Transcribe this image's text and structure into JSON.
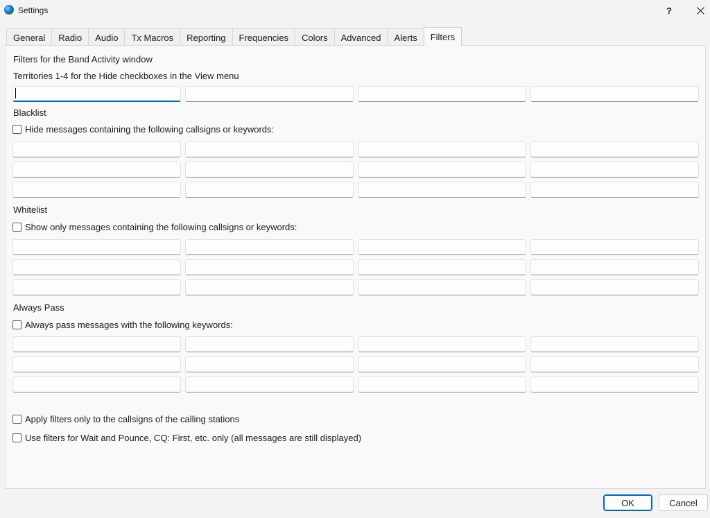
{
  "window": {
    "title": "Settings",
    "help_label": "?",
    "close_label": "close"
  },
  "tabs": [
    {
      "label": "General"
    },
    {
      "label": "Radio"
    },
    {
      "label": "Audio"
    },
    {
      "label": "Tx Macros"
    },
    {
      "label": "Reporting"
    },
    {
      "label": "Frequencies"
    },
    {
      "label": "Colors"
    },
    {
      "label": "Advanced"
    },
    {
      "label": "Alerts"
    },
    {
      "label": "Filters",
      "active": true
    }
  ],
  "filters": {
    "heading": "Filters for the Band Activity window",
    "territories": {
      "label": "Territories 1-4 for the Hide checkboxes in the View menu",
      "values": [
        "",
        "",
        "",
        ""
      ]
    },
    "blacklist": {
      "heading": "Blacklist",
      "checkbox_label": "Hide messages containing the following callsigns or keywords:",
      "checked": false,
      "values": [
        "",
        "",
        "",
        "",
        "",
        "",
        "",
        "",
        "",
        "",
        "",
        ""
      ]
    },
    "whitelist": {
      "heading": "Whitelist",
      "checkbox_label": "Show only messages containing the following callsigns or keywords:",
      "checked": false,
      "values": [
        "",
        "",
        "",
        "",
        "",
        "",
        "",
        "",
        "",
        "",
        "",
        ""
      ]
    },
    "always_pass": {
      "heading": "Always Pass",
      "checkbox_label": "Always pass messages with the following keywords:",
      "checked": false,
      "values": [
        "",
        "",
        "",
        "",
        "",
        "",
        "",
        "",
        "",
        "",
        "",
        ""
      ]
    },
    "options": [
      {
        "label": "Apply filters only to the callsigns of the calling stations",
        "checked": false
      },
      {
        "label": "Use filters for Wait and Pounce, CQ: First, etc. only (all messages are still displayed)",
        "checked": false
      }
    ]
  },
  "buttons": {
    "ok_label": "OK",
    "cancel_label": "Cancel"
  }
}
